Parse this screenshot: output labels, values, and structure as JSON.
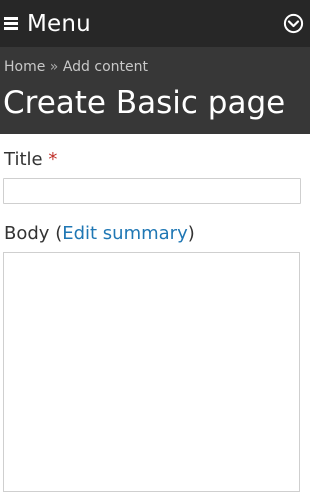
{
  "toolbar": {
    "menu_label": "Menu",
    "menu_icon": "hamburger-icon",
    "toggle_icon": "chevron-down-circle-icon"
  },
  "breadcrumb": {
    "items": [
      "Home",
      "Add content"
    ],
    "separator": "»"
  },
  "page": {
    "title": "Create Basic page"
  },
  "form": {
    "title_field": {
      "label": "Title",
      "required_marker": "*",
      "value": ""
    },
    "body_field": {
      "label": "Body",
      "open_paren": "(",
      "edit_summary_link": "Edit summary",
      "close_paren": ")",
      "value": ""
    }
  },
  "colors": {
    "topbar": "#272727",
    "header": "#373737",
    "link": "#1f77b4",
    "required": "#c0302a"
  }
}
